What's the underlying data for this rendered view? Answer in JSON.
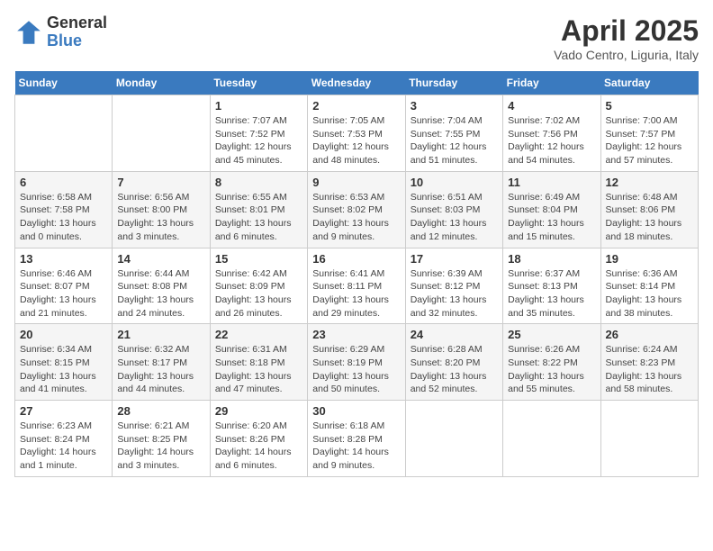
{
  "logo": {
    "general": "General",
    "blue": "Blue"
  },
  "header": {
    "title": "April 2025",
    "subtitle": "Vado Centro, Liguria, Italy"
  },
  "weekdays": [
    "Sunday",
    "Monday",
    "Tuesday",
    "Wednesday",
    "Thursday",
    "Friday",
    "Saturday"
  ],
  "weeks": [
    [
      {
        "day": "",
        "info": ""
      },
      {
        "day": "",
        "info": ""
      },
      {
        "day": "1",
        "info": "Sunrise: 7:07 AM\nSunset: 7:52 PM\nDaylight: 12 hours and 45 minutes."
      },
      {
        "day": "2",
        "info": "Sunrise: 7:05 AM\nSunset: 7:53 PM\nDaylight: 12 hours and 48 minutes."
      },
      {
        "day": "3",
        "info": "Sunrise: 7:04 AM\nSunset: 7:55 PM\nDaylight: 12 hours and 51 minutes."
      },
      {
        "day": "4",
        "info": "Sunrise: 7:02 AM\nSunset: 7:56 PM\nDaylight: 12 hours and 54 minutes."
      },
      {
        "day": "5",
        "info": "Sunrise: 7:00 AM\nSunset: 7:57 PM\nDaylight: 12 hours and 57 minutes."
      }
    ],
    [
      {
        "day": "6",
        "info": "Sunrise: 6:58 AM\nSunset: 7:58 PM\nDaylight: 13 hours and 0 minutes."
      },
      {
        "day": "7",
        "info": "Sunrise: 6:56 AM\nSunset: 8:00 PM\nDaylight: 13 hours and 3 minutes."
      },
      {
        "day": "8",
        "info": "Sunrise: 6:55 AM\nSunset: 8:01 PM\nDaylight: 13 hours and 6 minutes."
      },
      {
        "day": "9",
        "info": "Sunrise: 6:53 AM\nSunset: 8:02 PM\nDaylight: 13 hours and 9 minutes."
      },
      {
        "day": "10",
        "info": "Sunrise: 6:51 AM\nSunset: 8:03 PM\nDaylight: 13 hours and 12 minutes."
      },
      {
        "day": "11",
        "info": "Sunrise: 6:49 AM\nSunset: 8:04 PM\nDaylight: 13 hours and 15 minutes."
      },
      {
        "day": "12",
        "info": "Sunrise: 6:48 AM\nSunset: 8:06 PM\nDaylight: 13 hours and 18 minutes."
      }
    ],
    [
      {
        "day": "13",
        "info": "Sunrise: 6:46 AM\nSunset: 8:07 PM\nDaylight: 13 hours and 21 minutes."
      },
      {
        "day": "14",
        "info": "Sunrise: 6:44 AM\nSunset: 8:08 PM\nDaylight: 13 hours and 24 minutes."
      },
      {
        "day": "15",
        "info": "Sunrise: 6:42 AM\nSunset: 8:09 PM\nDaylight: 13 hours and 26 minutes."
      },
      {
        "day": "16",
        "info": "Sunrise: 6:41 AM\nSunset: 8:11 PM\nDaylight: 13 hours and 29 minutes."
      },
      {
        "day": "17",
        "info": "Sunrise: 6:39 AM\nSunset: 8:12 PM\nDaylight: 13 hours and 32 minutes."
      },
      {
        "day": "18",
        "info": "Sunrise: 6:37 AM\nSunset: 8:13 PM\nDaylight: 13 hours and 35 minutes."
      },
      {
        "day": "19",
        "info": "Sunrise: 6:36 AM\nSunset: 8:14 PM\nDaylight: 13 hours and 38 minutes."
      }
    ],
    [
      {
        "day": "20",
        "info": "Sunrise: 6:34 AM\nSunset: 8:15 PM\nDaylight: 13 hours and 41 minutes."
      },
      {
        "day": "21",
        "info": "Sunrise: 6:32 AM\nSunset: 8:17 PM\nDaylight: 13 hours and 44 minutes."
      },
      {
        "day": "22",
        "info": "Sunrise: 6:31 AM\nSunset: 8:18 PM\nDaylight: 13 hours and 47 minutes."
      },
      {
        "day": "23",
        "info": "Sunrise: 6:29 AM\nSunset: 8:19 PM\nDaylight: 13 hours and 50 minutes."
      },
      {
        "day": "24",
        "info": "Sunrise: 6:28 AM\nSunset: 8:20 PM\nDaylight: 13 hours and 52 minutes."
      },
      {
        "day": "25",
        "info": "Sunrise: 6:26 AM\nSunset: 8:22 PM\nDaylight: 13 hours and 55 minutes."
      },
      {
        "day": "26",
        "info": "Sunrise: 6:24 AM\nSunset: 8:23 PM\nDaylight: 13 hours and 58 minutes."
      }
    ],
    [
      {
        "day": "27",
        "info": "Sunrise: 6:23 AM\nSunset: 8:24 PM\nDaylight: 14 hours and 1 minute."
      },
      {
        "day": "28",
        "info": "Sunrise: 6:21 AM\nSunset: 8:25 PM\nDaylight: 14 hours and 3 minutes."
      },
      {
        "day": "29",
        "info": "Sunrise: 6:20 AM\nSunset: 8:26 PM\nDaylight: 14 hours and 6 minutes."
      },
      {
        "day": "30",
        "info": "Sunrise: 6:18 AM\nSunset: 8:28 PM\nDaylight: 14 hours and 9 minutes."
      },
      {
        "day": "",
        "info": ""
      },
      {
        "day": "",
        "info": ""
      },
      {
        "day": "",
        "info": ""
      }
    ]
  ]
}
